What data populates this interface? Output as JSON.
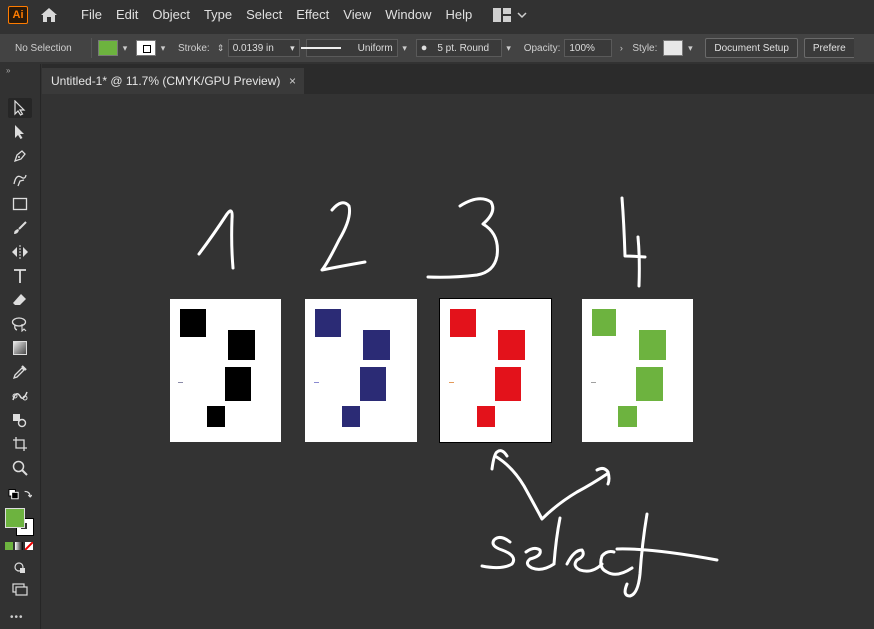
{
  "app": {
    "logo_text": "Ai",
    "brand_color": "#ff7c00"
  },
  "menu": {
    "items": [
      "File",
      "Edit",
      "Object",
      "Type",
      "Select",
      "Effect",
      "View",
      "Window",
      "Help"
    ]
  },
  "control_bar": {
    "selection_label": "No Selection",
    "fill_color": "#6db33f",
    "stroke_label": "Stroke:",
    "stroke_value": "0.0139 in",
    "profile_label": "Uniform",
    "brush_label": "5 pt. Round",
    "opacity_label": "Opacity:",
    "opacity_value": "100%",
    "style_label": "Style:",
    "doc_setup_label": "Document Setup",
    "prefs_label": "Prefere"
  },
  "document_tab": {
    "title": "Untitled-1* @ 11.7% (CMYK/GPU Preview)",
    "close": "×"
  },
  "tools": [
    "selection-icon",
    "direct-selection-icon",
    "pen-icon",
    "curvature-icon",
    "rectangle-icon",
    "paintbrush-icon",
    "width-icon",
    "type-icon",
    "eraser-icon",
    "lasso-icon",
    "gradient-icon",
    "eyedropper-icon",
    "blend-icon",
    "symbol-sprayer-icon",
    "artboard-icon",
    "zoom-icon"
  ],
  "toolbar_bottom": {
    "fill_color": "#6db33f",
    "stroke_color": "#ffffff",
    "more": "•••"
  },
  "artboards": [
    {
      "label": "1",
      "color": "#000000",
      "mark_color": "#8a8aa8",
      "selected": false
    },
    {
      "label": "2",
      "color": "#2b2b75",
      "mark_color": "#8a8ad0",
      "selected": false
    },
    {
      "label": "3",
      "color": "#e3121b",
      "mark_color": "#e39a5a",
      "selected": true
    },
    {
      "label": "4",
      "color": "#6db33f",
      "mark_color": "#a0a0a0",
      "selected": false
    }
  ],
  "annotation": {
    "text": "select"
  }
}
